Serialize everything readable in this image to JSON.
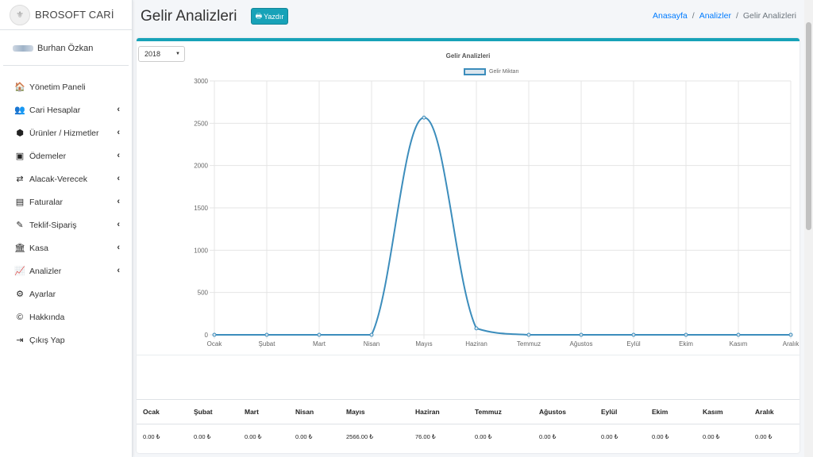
{
  "brand": {
    "name": "BROSOFT CARİ"
  },
  "user": {
    "name": "Burhan Özkan"
  },
  "sidebar": {
    "items": [
      {
        "label": "Yönetim Paneli",
        "icon": "home-icon",
        "glyph": "🏠",
        "chevron": false
      },
      {
        "label": "Cari Hesaplar",
        "icon": "users-icon",
        "glyph": "👥",
        "chevron": true
      },
      {
        "label": "Ürünler / Hizmetler",
        "icon": "cubes-icon",
        "glyph": "⬢",
        "chevron": true
      },
      {
        "label": "Ödemeler",
        "icon": "money-bill-icon",
        "glyph": "▣",
        "chevron": true
      },
      {
        "label": "Alacak-Verecek",
        "icon": "exchange-icon",
        "glyph": "⇄",
        "chevron": true
      },
      {
        "label": "Faturalar",
        "icon": "file-icon",
        "glyph": "▤",
        "chevron": true
      },
      {
        "label": "Teklif-Sipariş",
        "icon": "edit-icon",
        "glyph": "✎",
        "chevron": true
      },
      {
        "label": "Kasa",
        "icon": "bank-icon",
        "glyph": "🏛",
        "chevron": true
      },
      {
        "label": "Analizler",
        "icon": "chart-line-icon",
        "glyph": "📈",
        "chevron": true
      },
      {
        "label": "Ayarlar",
        "icon": "cogs-icon",
        "glyph": "⚙",
        "chevron": false
      },
      {
        "label": "Hakkında",
        "icon": "copyright-icon",
        "glyph": "©",
        "chevron": false
      },
      {
        "label": "Çıkış Yap",
        "icon": "sign-out-icon",
        "glyph": "⇥",
        "chevron": false
      }
    ]
  },
  "header": {
    "title": "Gelir Analizleri",
    "print_label": "Yazdır",
    "breadcrumb": [
      "Anasayfa",
      "Analizler",
      "Gelir Analizleri"
    ]
  },
  "filter": {
    "year": "2018"
  },
  "chart_data": {
    "type": "line",
    "title": "Gelir Analizleri",
    "categories": [
      "Ocak",
      "Şubat",
      "Mart",
      "Nisan",
      "Mayıs",
      "Haziran",
      "Temmuz",
      "Ağustos",
      "Eylül",
      "Ekim",
      "Kasım",
      "Aralık"
    ],
    "category_labels": [
      "Ocak",
      "Şubat",
      "Mart",
      "Nisan",
      "Mayıs",
      "Haziran",
      "Temmuz",
      "Ağustos",
      "Eylül",
      "Ekim",
      "Kasım",
      "Aralık"
    ],
    "series": [
      {
        "name": "Gelir Miktarı",
        "values": [
          0,
          0,
          0,
          0,
          2566,
          76,
          0,
          0,
          0,
          0,
          0,
          0
        ]
      }
    ],
    "ylim": [
      0,
      3000
    ],
    "yticks": [
      0,
      500,
      1000,
      1500,
      2000,
      2500,
      3000
    ],
    "grid": true,
    "legend": "top-center",
    "line_color": "#3c8dbc"
  },
  "table": {
    "headers": [
      "Ocak",
      "Şubat",
      "Mart",
      "Nisan",
      "Mayıs",
      "Haziran",
      "Temmuz",
      "Ağustos",
      "Eylül",
      "Ekim",
      "Kasım",
      "Aralık"
    ],
    "values": [
      "0.00 ₺",
      "0.00 ₺",
      "0.00 ₺",
      "0.00 ₺",
      "2566.00 ₺",
      "76.00 ₺",
      "0.00 ₺",
      "0.00 ₺",
      "0.00 ₺",
      "0.00 ₺",
      "0.00 ₺",
      "0.00 ₺"
    ]
  }
}
